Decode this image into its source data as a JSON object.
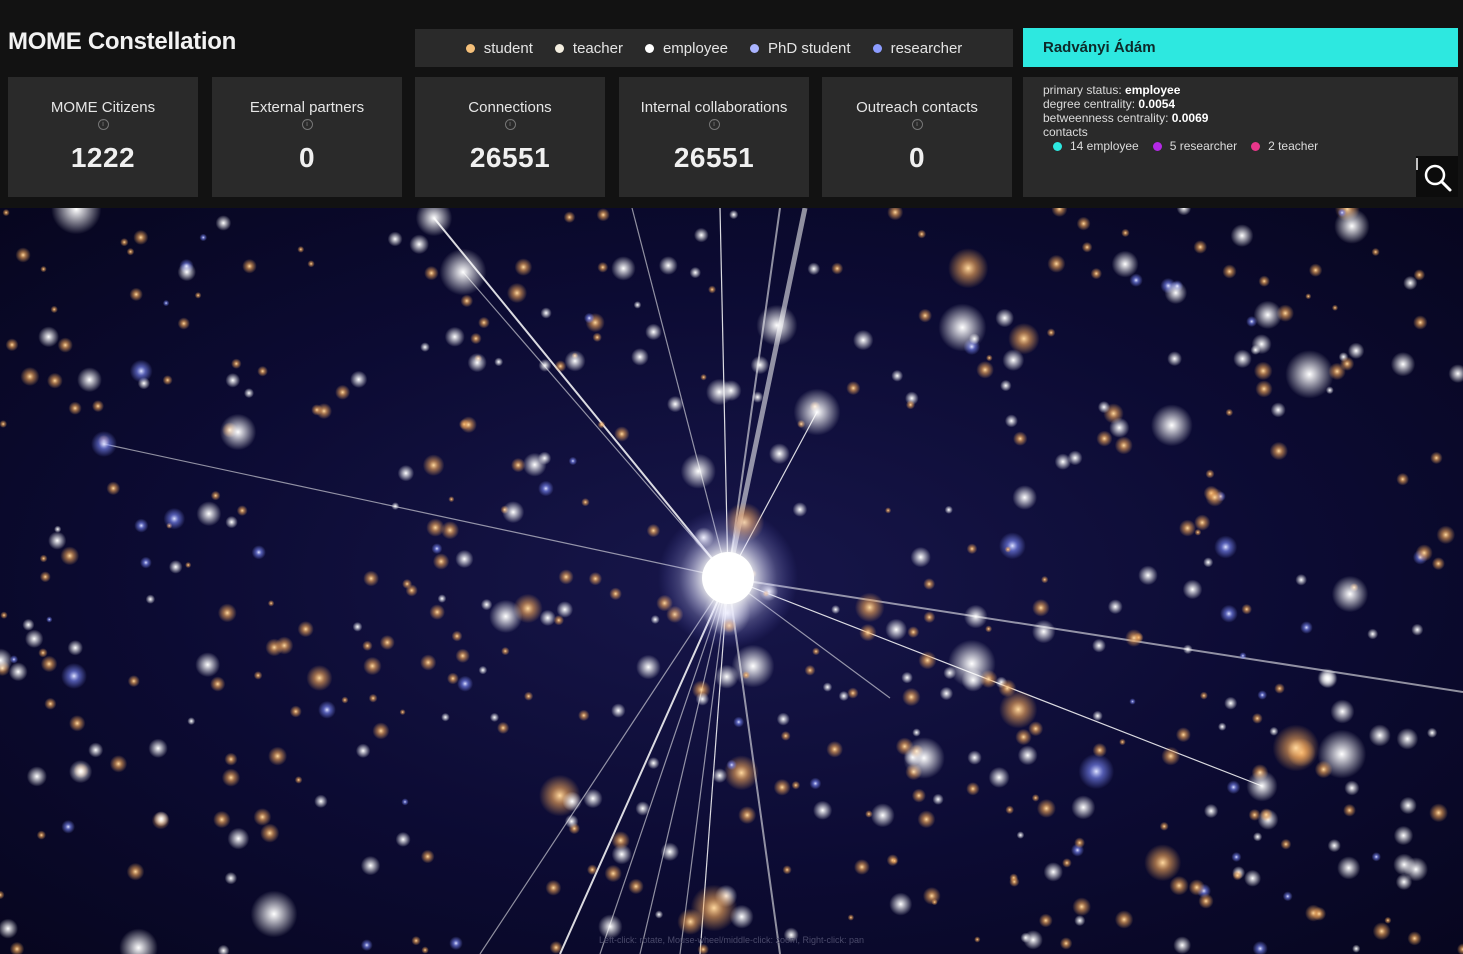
{
  "app": {
    "title": "MOME Constellation"
  },
  "legend": [
    {
      "label": "student",
      "color": "#f5c07a"
    },
    {
      "label": "teacher",
      "color": "#f3eee0"
    },
    {
      "label": "employee",
      "color": "#ffffff"
    },
    {
      "label": "PhD student",
      "color": "#aab4ff"
    },
    {
      "label": "researcher",
      "color": "#8c9cff"
    }
  ],
  "stats": [
    {
      "label": "MOME Citizens",
      "value": "1222"
    },
    {
      "label": "External partners",
      "value": "0"
    },
    {
      "label": "Connections",
      "value": "26551"
    },
    {
      "label": "Internal collaborations",
      "value": "26551"
    },
    {
      "label": "Outreach contacts",
      "value": "0"
    }
  ],
  "selected_person": {
    "name": "Radványi Ádám",
    "primary_status_label": "primary status:",
    "primary_status_value": "employee",
    "degree_label": "degree centrality:",
    "degree_value": "0.0054",
    "betweenness_label": "betweenness centrality:",
    "betweenness_value": "0.0069",
    "contacts_label": "contacts",
    "contacts": [
      {
        "label": "14 employee",
        "color": "#2de8e0"
      },
      {
        "label": "5 researcher",
        "color": "#b429e6"
      },
      {
        "label": "2 teacher",
        "color": "#e8368a"
      }
    ]
  },
  "search": {
    "icon": "search-icon"
  },
  "viz": {
    "hint": "Left-click: rotate, Mouse-wheel/middle-click: zoom, Right-click: pan",
    "background": "#0c0b33",
    "hub_color": "#ffffff",
    "student_color": "#f5a95a",
    "employee_color": "#ffffff",
    "researcher_color": "#7f8dff"
  }
}
